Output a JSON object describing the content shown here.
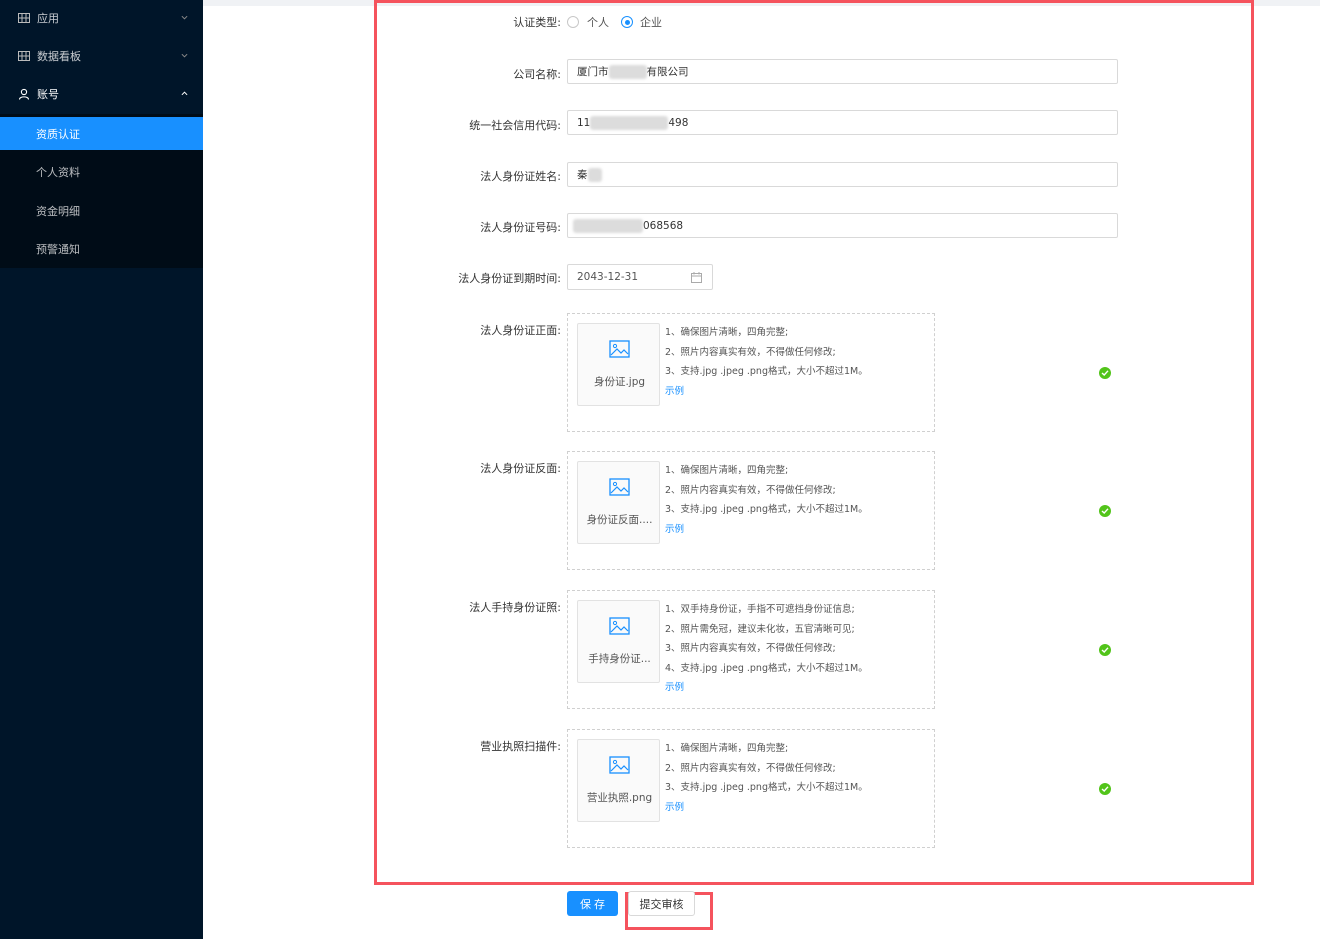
{
  "sidebar": {
    "top_items": [
      {
        "label": "应用",
        "icon": "grid-icon",
        "arrow": "chevron-down-icon"
      },
      {
        "label": "数据看板",
        "icon": "grid-icon",
        "arrow": "chevron-down-icon"
      },
      {
        "label": "账号",
        "icon": "user-icon",
        "arrow": "chevron-up-icon"
      }
    ],
    "sub_items": [
      {
        "label": "资质认证",
        "active": true
      },
      {
        "label": "个人资料",
        "active": false
      },
      {
        "label": "资金明细",
        "active": false
      },
      {
        "label": "预警通知",
        "active": false
      }
    ]
  },
  "form": {
    "cert_type": {
      "label": "认证类型:",
      "options": [
        "个人",
        "企业"
      ],
      "selected": "企业"
    },
    "company_name": {
      "label": "公司名称:",
      "value_prefix": "厦门市",
      "value_suffix": "有限公司"
    },
    "credit_code": {
      "label": "统一社会信用代码:",
      "value_prefix": "11",
      "value_suffix": "498"
    },
    "legal_name": {
      "label": "法人身份证姓名:",
      "value_prefix": "秦"
    },
    "legal_id": {
      "label": "法人身份证号码:",
      "value_suffix": "068568"
    },
    "id_expiry": {
      "label": "法人身份证到期时间:",
      "value": "2043-12-31"
    },
    "uploads": [
      {
        "label": "法人身份证正面:",
        "filename": "身份证.jpg",
        "tips": [
          "1、确保图片清晰，四角完整;",
          "2、照片内容真实有效，不得做任何修改;",
          "3、支持.jpg .jpeg .png格式，大小不超过1M。"
        ],
        "example": "示例"
      },
      {
        "label": "法人身份证反面:",
        "filename": "身份证反面....",
        "tips": [
          "1、确保图片清晰，四角完整;",
          "2、照片内容真实有效，不得做任何修改;",
          "3、支持.jpg .jpeg .png格式，大小不超过1M。"
        ],
        "example": "示例"
      },
      {
        "label": "法人手持身份证照:",
        "filename": "手持身份证...",
        "tips": [
          "1、双手持身份证，手指不可遮挡身份证信息;",
          "2、照片需免冠，建议未化妆，五官清晰可见;",
          "3、照片内容真实有效，不得做任何修改;",
          "4、支持.jpg .jpeg .png格式，大小不超过1M。"
        ],
        "example": "示例"
      },
      {
        "label": "营业执照扫描件:",
        "filename": "营业执照.png",
        "tips": [
          "1、确保图片清晰，四角完整;",
          "2、照片内容真实有效，不得做任何修改;",
          "3、支持.jpg .jpeg .png格式，大小不超过1M。"
        ],
        "example": "示例"
      }
    ]
  },
  "buttons": {
    "save": "保存",
    "submit": "提交审核"
  },
  "colors": {
    "primary": "#1890ff",
    "sidebar": "#001529",
    "highlight": "#f5535d",
    "success": "#52c41a"
  }
}
